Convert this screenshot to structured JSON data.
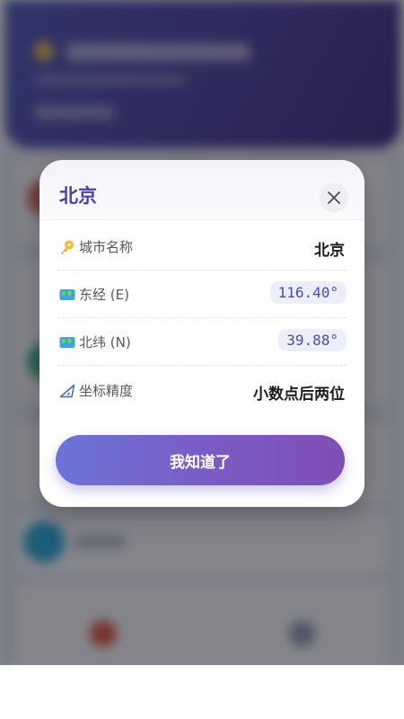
{
  "dialog": {
    "title": "北京",
    "rows": [
      {
        "label": "城市名称",
        "value": "北京",
        "icon": "key-icon"
      },
      {
        "label": "东经 (E)",
        "value": "116.40°",
        "icon": "world-map-icon"
      },
      {
        "label": "北纬 (N)",
        "value": "39.88°",
        "icon": "world-map-icon"
      },
      {
        "label": "坐标精度",
        "value": "小数点后两位",
        "icon": "triangular-ruler-icon"
      }
    ],
    "confirm_label": "我知道了"
  },
  "colors": {
    "accent": "#4b3fa8",
    "button_start": "#6c73d6",
    "button_end": "#7f4fb4",
    "value_chip_bg": "#eceefb"
  }
}
